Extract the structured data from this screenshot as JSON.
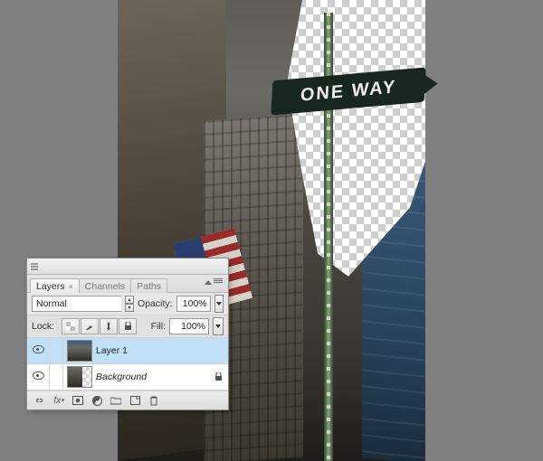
{
  "canvas": {
    "sign_text": "ONE WAY"
  },
  "panel": {
    "tabs": [
      {
        "label": "Layers",
        "active": true
      },
      {
        "label": "Channels",
        "active": false
      },
      {
        "label": "Paths",
        "active": false
      }
    ],
    "blend_mode": "Normal",
    "opacity_label": "Opacity:",
    "opacity_value": "100%",
    "lock_label": "Lock:",
    "fill_label": "Fill:",
    "fill_value": "100%",
    "layers": [
      {
        "name": "Layer 1",
        "visible": true,
        "selected": true,
        "locked": false,
        "thumb": "img"
      },
      {
        "name": "Background",
        "visible": true,
        "selected": false,
        "locked": true,
        "thumb": "bg",
        "italic": true
      }
    ],
    "footer_icons": [
      "link",
      "fx",
      "mask",
      "adjust",
      "group",
      "new",
      "trash"
    ]
  }
}
